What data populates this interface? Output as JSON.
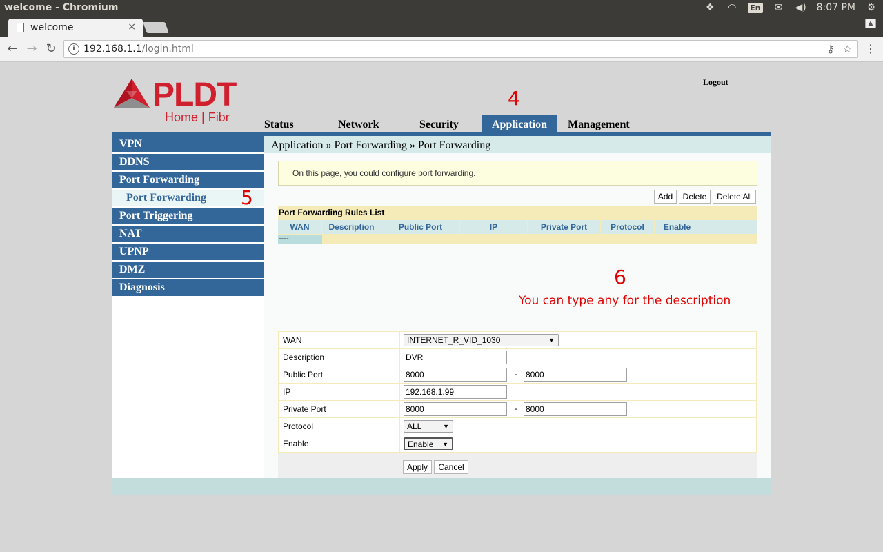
{
  "os": {
    "window_title": "welcome - Chromium",
    "language": "En",
    "time": "8:07 PM"
  },
  "browser": {
    "tab_title": "welcome",
    "url_host": "192.168.1.1",
    "url_path": "/login.html"
  },
  "header": {
    "logo_main": "PLDT",
    "logo_sub": "Home | Fibr",
    "logout": "Logout",
    "nav": [
      {
        "label": "Status"
      },
      {
        "label": "Network"
      },
      {
        "label": "Security"
      },
      {
        "label": "Application",
        "active": true
      },
      {
        "label": "Management"
      }
    ]
  },
  "sidebar": {
    "items": [
      {
        "label": "VPN"
      },
      {
        "label": "DDNS"
      },
      {
        "label": "Port Forwarding"
      },
      {
        "label": "Port Forwarding",
        "sub": true
      },
      {
        "label": "Port Triggering"
      },
      {
        "label": "NAT"
      },
      {
        "label": "UPNP"
      },
      {
        "label": "DMZ"
      },
      {
        "label": "Diagnosis"
      }
    ]
  },
  "main": {
    "breadcrumb": "Application » Port Forwarding » Port Forwarding",
    "info": "On this page, you could configure port forwarding.",
    "buttons": {
      "add": "Add",
      "delete": "Delete",
      "delete_all": "Delete All"
    },
    "rules": {
      "title": "Port Forwarding Rules List",
      "columns": [
        "WAN",
        "Description",
        "Public Port",
        "IP",
        "Private Port",
        "Protocol",
        "Enable"
      ],
      "empty_row": "----"
    },
    "form": {
      "wan_label": "WAN",
      "wan_value": "INTERNET_R_VID_1030",
      "description_label": "Description",
      "description_value": "DVR",
      "public_port_label": "Public Port",
      "public_port_start": "8000",
      "public_port_end": "8000",
      "ip_label": "IP",
      "ip_value": "192.168.1.99",
      "private_port_label": "Private Port",
      "private_port_start": "8000",
      "private_port_end": "8000",
      "protocol_label": "Protocol",
      "protocol_value": "ALL",
      "enable_label": "Enable",
      "enable_value": "Enable",
      "separator": "-",
      "apply": "Apply",
      "cancel": "Cancel"
    }
  },
  "annotations": {
    "step4": "4",
    "step5": "5",
    "step6": "6",
    "description_hint": "You can type any for the description"
  },
  "colors": {
    "brand_red": "#d0202e",
    "nav_blue": "#336699",
    "annotation_red": "#e00000"
  }
}
